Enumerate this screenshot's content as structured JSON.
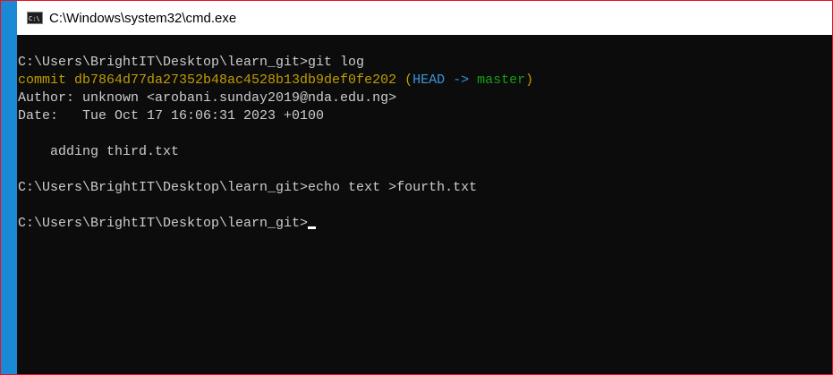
{
  "window": {
    "title": "C:\\Windows\\system32\\cmd.exe",
    "icon_label": "C:\\",
    "icon": "terminal-icon"
  },
  "console": {
    "prompt1": "C:\\Users\\BrightIT\\Desktop\\learn_git>git log",
    "commit_prefix": "commit db7864d77da27352b48ac4528b13db9def0fe202 ",
    "paren_open": "(",
    "head_ref": "HEAD -> ",
    "branch": "master",
    "paren_close": ")",
    "author": "Author: unknown <arobani.sunday2019@nda.edu.ng>",
    "date": "Date:   Tue Oct 17 16:06:31 2023 +0100",
    "message": "    adding third.txt",
    "prompt2": "C:\\Users\\BrightIT\\Desktop\\learn_git>echo text >fourth.txt",
    "prompt3": "C:\\Users\\BrightIT\\Desktop\\learn_git>"
  },
  "colors": {
    "background": "#0c0c0c",
    "text": "#cccccc",
    "commit": "#c19c00",
    "head": "#3a96dd",
    "branch": "#13a10e",
    "window_border": "#e81123"
  }
}
